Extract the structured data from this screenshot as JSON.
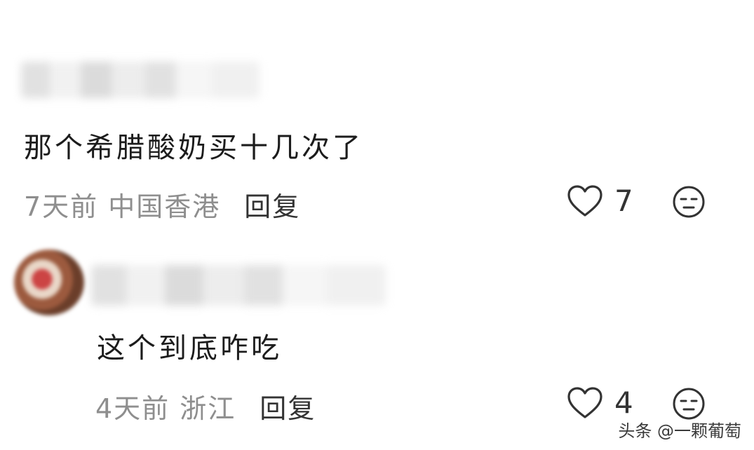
{
  "comments": [
    {
      "text": "那个希腊酸奶买十几次了",
      "time": "7天前",
      "location": "中国香港",
      "reply_label": "回复",
      "likes": "7"
    },
    {
      "text": "这个到底咋吃",
      "time": "4天前",
      "location": "浙江",
      "reply_label": "回复",
      "likes": "4"
    }
  ],
  "watermark": "头条 @一颗葡萄",
  "icons": {
    "like": "heart-outline-icon",
    "emoji": "neutral-face-icon"
  }
}
